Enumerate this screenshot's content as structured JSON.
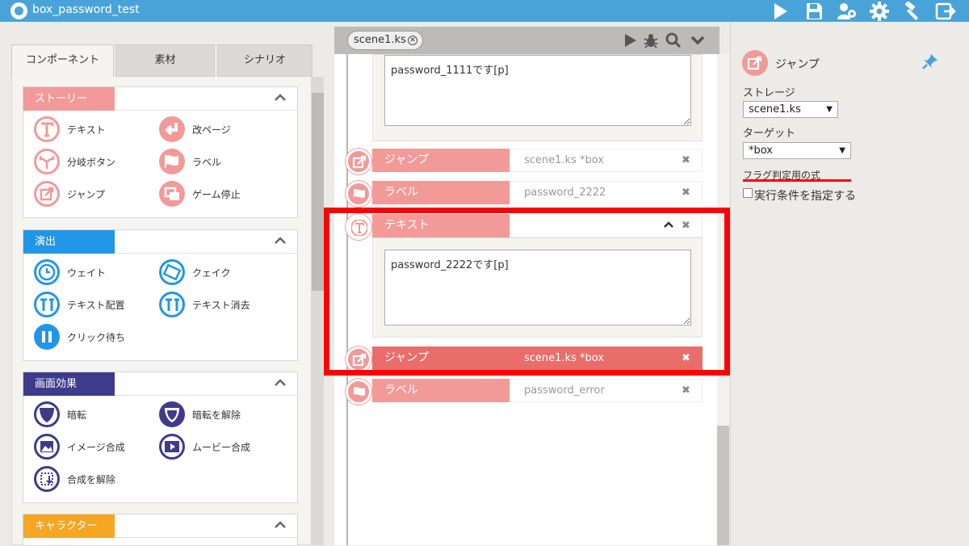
{
  "app": {
    "title": "box_password_test",
    "accent": "#4aa3d8"
  },
  "toolbar": {
    "icons": [
      "play-icon",
      "save-icon",
      "users-icon",
      "gear-icon",
      "hammer-icon",
      "export-icon"
    ]
  },
  "left": {
    "tabs": [
      {
        "label": "コンポーネント",
        "active": true
      },
      {
        "label": "素材",
        "active": false
      },
      {
        "label": "シナリオ",
        "active": false
      }
    ],
    "groups": [
      {
        "title": "ストーリー",
        "color": "#f29a98",
        "items": [
          {
            "label": "テキスト",
            "icon": "text-T-icon"
          },
          {
            "label": "改ページ",
            "icon": "newpage-arrow-icon"
          },
          {
            "label": "分岐ボタン",
            "icon": "branch-icon"
          },
          {
            "label": "ラベル",
            "icon": "flag-icon"
          },
          {
            "label": "ジャンプ",
            "icon": "jump-icon"
          },
          {
            "label": "ゲーム停止",
            "icon": "stop-game-icon"
          }
        ]
      },
      {
        "title": "演出",
        "color": "#2196e8",
        "items": [
          {
            "label": "ウェイト",
            "icon": "clock-icon"
          },
          {
            "label": "クェイク",
            "icon": "quake-icon"
          },
          {
            "label": "テキスト配置",
            "icon": "text-place-icon"
          },
          {
            "label": "テキスト消去",
            "icon": "text-clear-icon"
          },
          {
            "label": "クリック待ち",
            "icon": "pause-icon"
          }
        ]
      },
      {
        "title": "画面効果",
        "color": "#3f3b8c",
        "items": [
          {
            "label": "暗転",
            "icon": "fade-out-icon"
          },
          {
            "label": "暗転を解除",
            "icon": "fade-in-icon"
          },
          {
            "label": "イメージ合成",
            "icon": "image-composite-icon"
          },
          {
            "label": "ムービー合成",
            "icon": "movie-composite-icon"
          },
          {
            "label": "合成を解除",
            "icon": "release-composite-icon"
          }
        ]
      },
      {
        "title": "キャラクター",
        "color": "#f5a623",
        "items": []
      }
    ]
  },
  "center": {
    "tab": "scene1.ks",
    "top_textarea": "password_1111です[p]",
    "blocks": [
      {
        "title": "ジャンプ",
        "value": "scene1.ks *box",
        "icon": "jump-icon"
      },
      {
        "title": "ラベル",
        "value": "password_2222",
        "icon": "flag-icon"
      },
      {
        "title": "テキスト",
        "value": "",
        "icon": "text-T-icon",
        "body": "password_2222です[p]"
      },
      {
        "title": "ジャンプ",
        "value": "scene1.ks *box",
        "icon": "jump-icon",
        "selected": true
      },
      {
        "title": "ラベル",
        "value": "password_error",
        "icon": "flag-icon"
      }
    ]
  },
  "right": {
    "title": "ジャンプ",
    "storage_label": "ストレージ",
    "storage_value": "scene1.ks",
    "target_label": "ターゲット",
    "target_value": "*box",
    "flag_label": "フラグ判定用の式",
    "condition_label": "実行条件を指定する"
  }
}
